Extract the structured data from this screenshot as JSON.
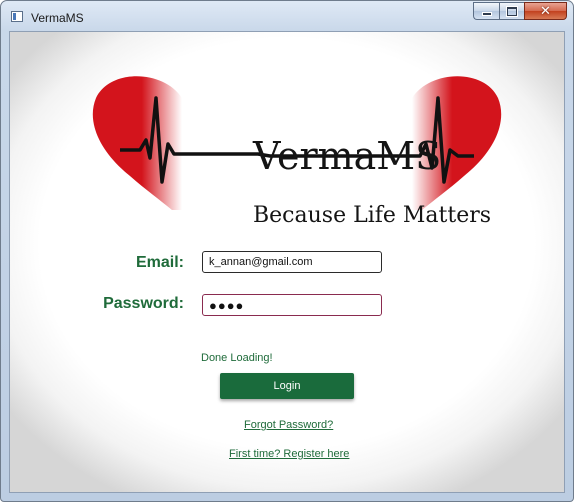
{
  "window": {
    "title": "VermaMS",
    "app_icon": "window-app-icon",
    "minimize_icon": "minimize-icon",
    "maximize_icon": "maximize-icon",
    "close_glyph": "✕"
  },
  "logo": {
    "title": "VermaMS",
    "tagline": "Because Life Matters",
    "accent_color": "#d3141c",
    "line_color": "#111111"
  },
  "form": {
    "email_label": "Email:",
    "email_value": "k_annan@gmail.com",
    "password_label": "Password:",
    "password_value": "●●●●"
  },
  "status": {
    "text": "Done Loading!"
  },
  "actions": {
    "login_label": "Login",
    "forgot_password_label": "Forgot Password?",
    "register_label": "First time? Register here"
  },
  "colors": {
    "label_green": "#1f6b3a",
    "button_green": "#1a6b3c"
  }
}
